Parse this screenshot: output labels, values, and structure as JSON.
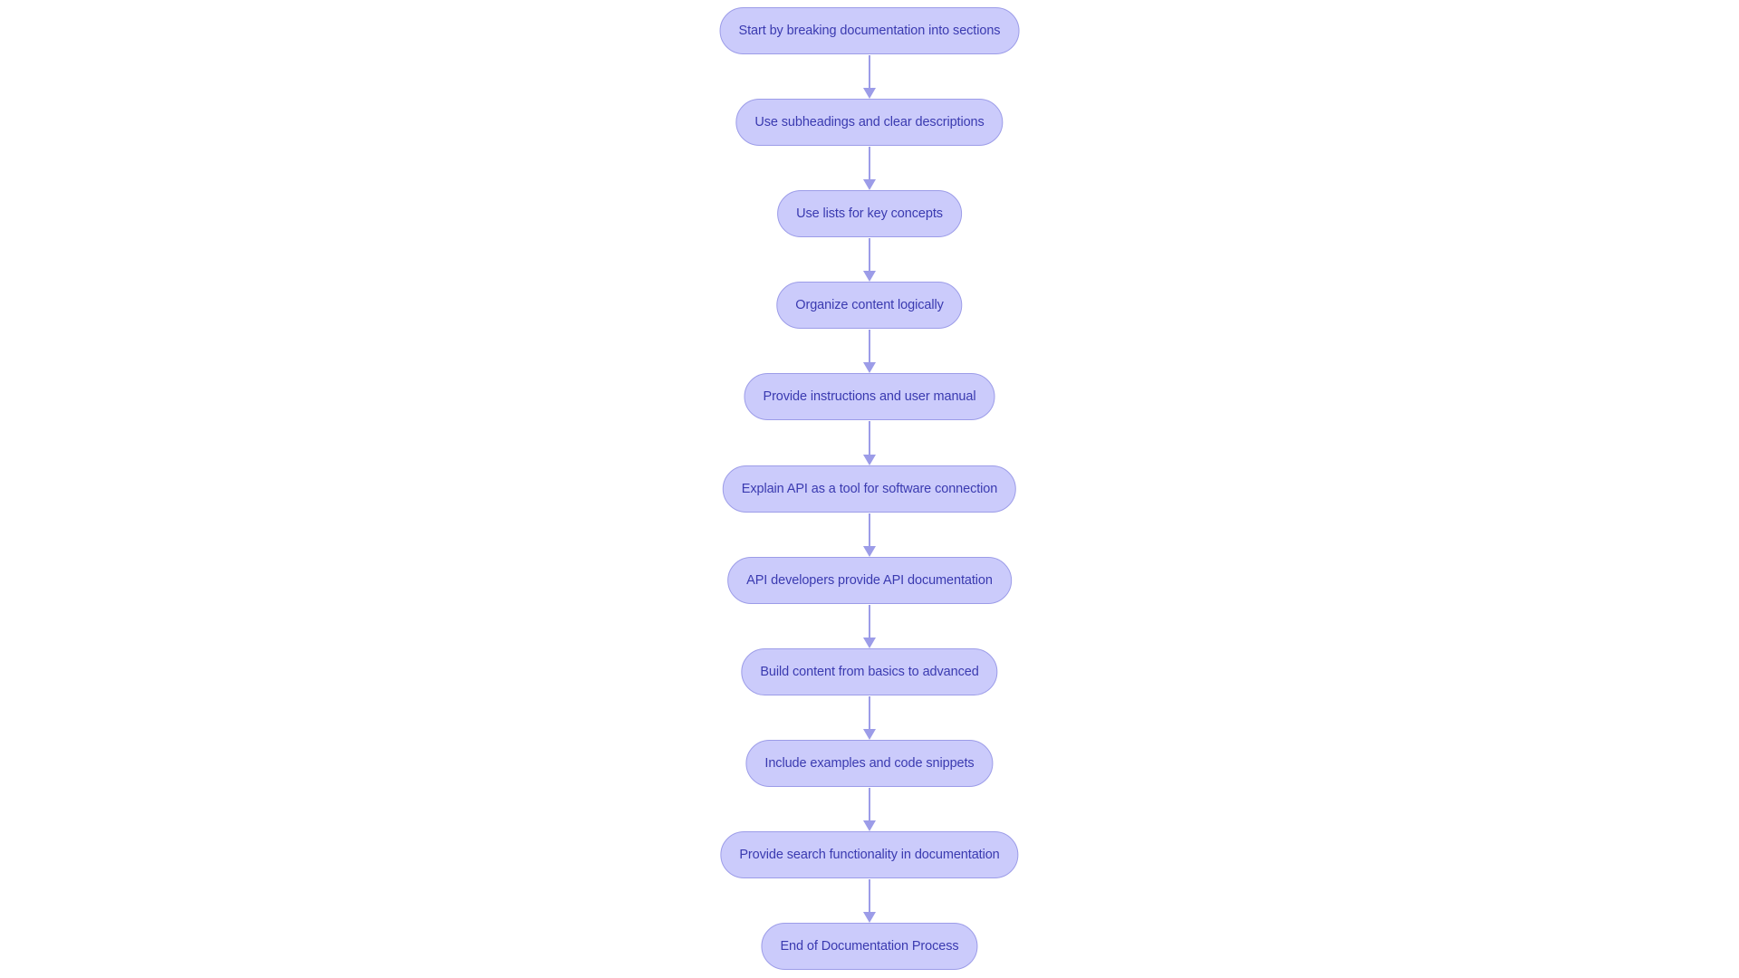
{
  "diagram": {
    "type": "flowchart",
    "direction": "top-down",
    "colors": {
      "node_fill": "#cbcbfb",
      "node_stroke": "#9c9ce8",
      "text": "#3a3ab0",
      "edge": "#9c9ce8"
    },
    "nodes": [
      "Start by breaking documentation into sections",
      "Use subheadings and clear descriptions",
      "Use lists for key concepts",
      "Organize content logically",
      "Provide instructions and user manual",
      "Explain API as a tool for software connection",
      "API developers provide API documentation",
      "Build content from basics to advanced",
      "Include examples and code snippets",
      "Provide search functionality in documentation",
      "End of Documentation Process"
    ],
    "edges": [
      [
        0,
        1
      ],
      [
        1,
        2
      ],
      [
        2,
        3
      ],
      [
        3,
        4
      ],
      [
        4,
        5
      ],
      [
        5,
        6
      ],
      [
        6,
        7
      ],
      [
        7,
        8
      ],
      [
        8,
        9
      ],
      [
        9,
        10
      ]
    ]
  }
}
